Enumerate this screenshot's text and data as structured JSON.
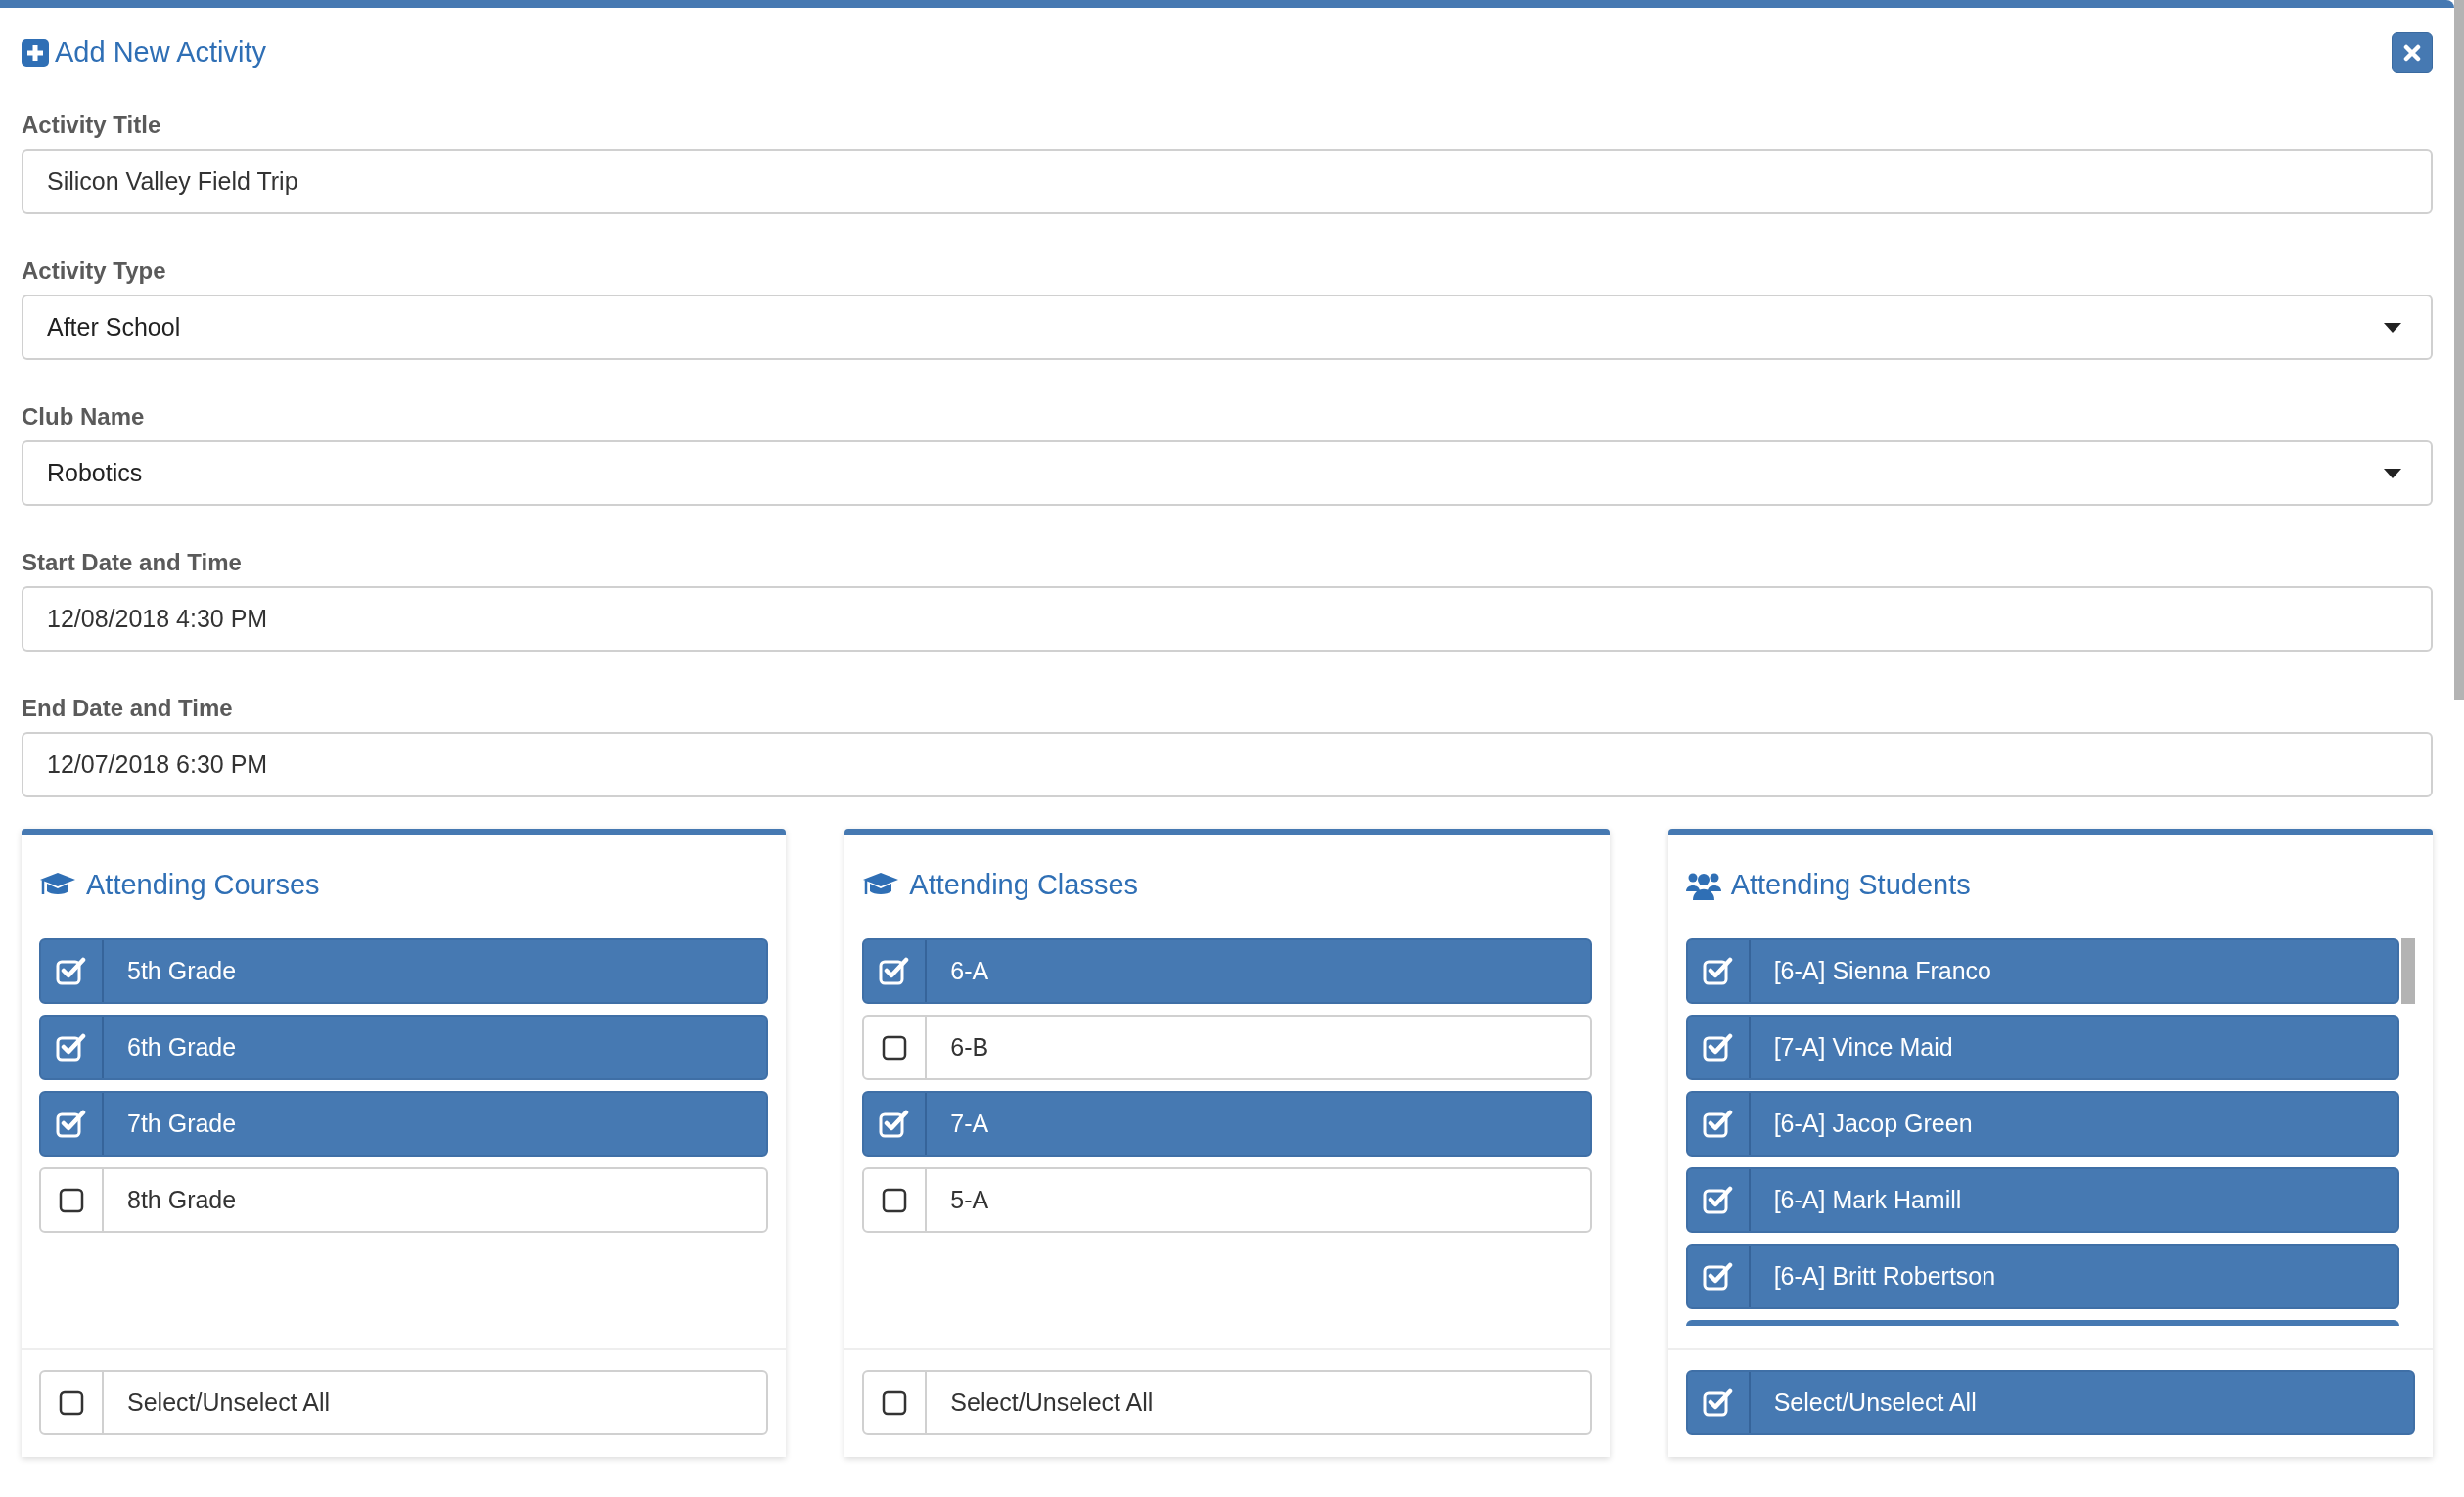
{
  "dialog": {
    "title": "Add New Activity"
  },
  "fields": [
    {
      "label": "Activity Title",
      "kind": "text",
      "value": "Silicon Valley Field Trip"
    },
    {
      "label": "Activity Type",
      "kind": "select",
      "value": "After School"
    },
    {
      "label": "Club Name",
      "kind": "select",
      "value": "Robotics"
    },
    {
      "label": "Start Date and Time",
      "kind": "text",
      "value": "12/08/2018 4:30 PM"
    },
    {
      "label": "End Date and Time",
      "kind": "text",
      "value": "12/07/2018 6:30 PM"
    }
  ],
  "panels": [
    {
      "title": "Attending Courses",
      "kind": "cap",
      "scrollable": false,
      "items": [
        {
          "label": "5th Grade",
          "checked": true
        },
        {
          "label": "6th Grade",
          "checked": true
        },
        {
          "label": "7th Grade",
          "checked": true
        },
        {
          "label": "8th Grade",
          "checked": false
        }
      ],
      "select_all": {
        "label": "Select/Unselect All",
        "checked": false
      }
    },
    {
      "title": "Attending Classes",
      "kind": "cap",
      "scrollable": false,
      "items": [
        {
          "label": "6-A",
          "checked": true
        },
        {
          "label": "6-B",
          "checked": false
        },
        {
          "label": "7-A",
          "checked": true
        },
        {
          "label": "5-A",
          "checked": false
        }
      ],
      "select_all": {
        "label": "Select/Unselect All",
        "checked": false
      }
    },
    {
      "title": "Attending Students",
      "kind": "people",
      "scrollable": true,
      "items": [
        {
          "label": "[6-A] Sienna Franco",
          "checked": true
        },
        {
          "label": "[7-A] Vince Maid",
          "checked": true
        },
        {
          "label": "[6-A] Jacop Green",
          "checked": true
        },
        {
          "label": "[6-A] Mark Hamill",
          "checked": true
        },
        {
          "label": "[6-A] Britt Robertson",
          "checked": true
        }
      ],
      "select_all": {
        "label": "Select/Unselect All",
        "checked": true
      }
    }
  ]
}
